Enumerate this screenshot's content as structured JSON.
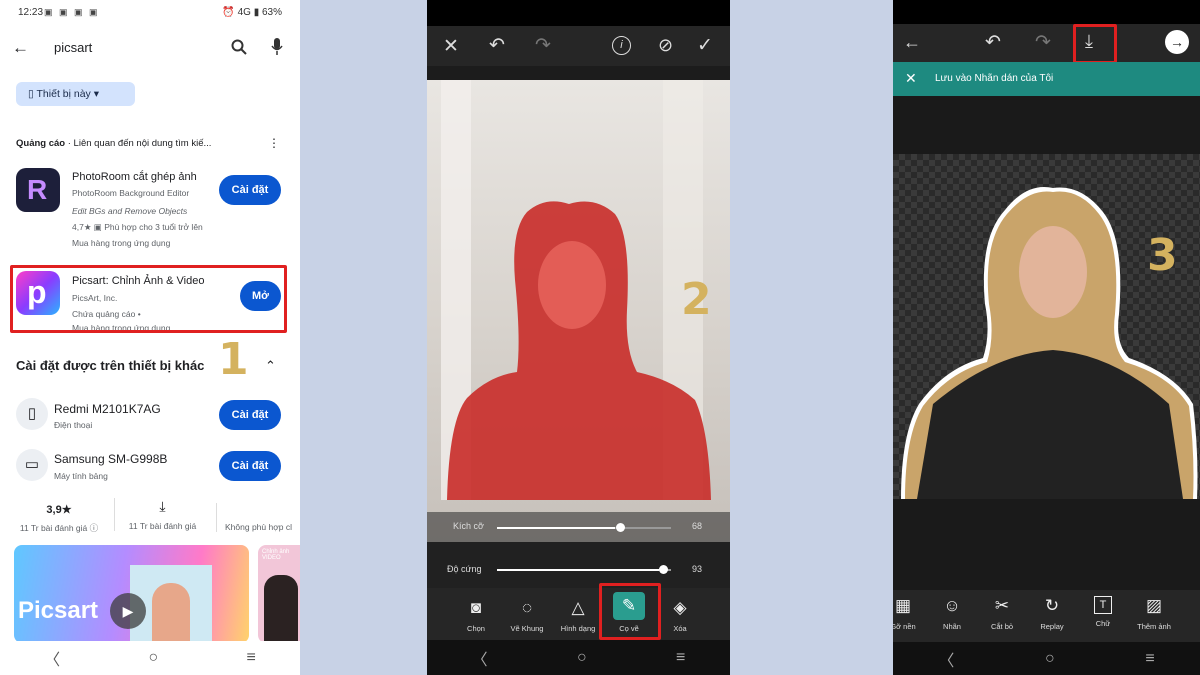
{
  "colors": {
    "accent": "#0b57d0",
    "highlight": "#e02020",
    "step": "#d4b25f",
    "save_bar": "#1e8a80"
  },
  "panel1": {
    "status": {
      "time": "12:23",
      "icons": "▣ ▣ ▣ ▣",
      "right": "⏰ 4G ▮ 63%",
      "battery": "63%"
    },
    "search": {
      "query": "picsart"
    },
    "filter_chip": "Thiết bị này",
    "ad_header": {
      "label": "Quảng cáo",
      "text": "Liên quan đến nội dung tìm kiế..."
    },
    "apps": [
      {
        "name": "PhotoRoom cắt ghép ảnh",
        "dev": "PhotoRoom Background Editor",
        "tag": "Edit BGs and Remove Objects",
        "rating": "4,7★",
        "age": "Phù hợp cho 3 tuổi trở lên",
        "iap": "Mua hàng trong ứng dụng",
        "button": "Cài đặt"
      },
      {
        "name": "Picsart: Chỉnh Ảnh & Video",
        "dev": "PicsArt, Inc.",
        "ads": "Chứa quảng cáo",
        "iap": "Mua hàng trong ứng dụng",
        "button": "Mở"
      }
    ],
    "section_title": "Cài đặt được trên thiết bị khác",
    "devices": [
      {
        "name": "Redmi M2101K7AG",
        "type": "Điện thoại",
        "button": "Cài đặt"
      },
      {
        "name": "Samsung SM-G998B",
        "type": "Máy tính bảng",
        "button": "Cài đặt"
      }
    ],
    "stats": [
      {
        "value": "3,9★",
        "label": "11 Tr bài đánh giá ⓘ"
      },
      {
        "value": "⤓",
        "label": "11 Tr bài đánh giá"
      },
      {
        "value": "",
        "label": "Không phù hợp cl"
      }
    ],
    "banner": {
      "logo": "Picsart",
      "thumb_text": "Chỉnh ảnh VIDEO"
    },
    "step": "1"
  },
  "panel2": {
    "sliders": [
      {
        "label": "Kích cỡ",
        "value": "68",
        "fill": 0.68
      },
      {
        "label": "Độ cứng",
        "value": "93",
        "fill": 0.93
      }
    ],
    "tools": [
      {
        "label": "Chọn",
        "glyph": "◙"
      },
      {
        "label": "Vẽ Khung",
        "glyph": "◌"
      },
      {
        "label": "Hình dạng",
        "glyph": "△"
      },
      {
        "label": "Cọ vẽ",
        "glyph": "✎"
      },
      {
        "label": "Xóa",
        "glyph": "◈"
      }
    ],
    "step": "2"
  },
  "panel3": {
    "save_text": "Lưu vào Nhãn dán của Tôi",
    "tools": [
      {
        "label": "Gỡ nền",
        "glyph": "▦"
      },
      {
        "label": "Nhãn",
        "glyph": "☺"
      },
      {
        "label": "Cắt bỏ",
        "glyph": "✂"
      },
      {
        "label": "Replay",
        "glyph": "↻"
      },
      {
        "label": "Chữ",
        "glyph": "T"
      },
      {
        "label": "Thêm ảnh",
        "glyph": "▨"
      }
    ],
    "step": "3"
  }
}
